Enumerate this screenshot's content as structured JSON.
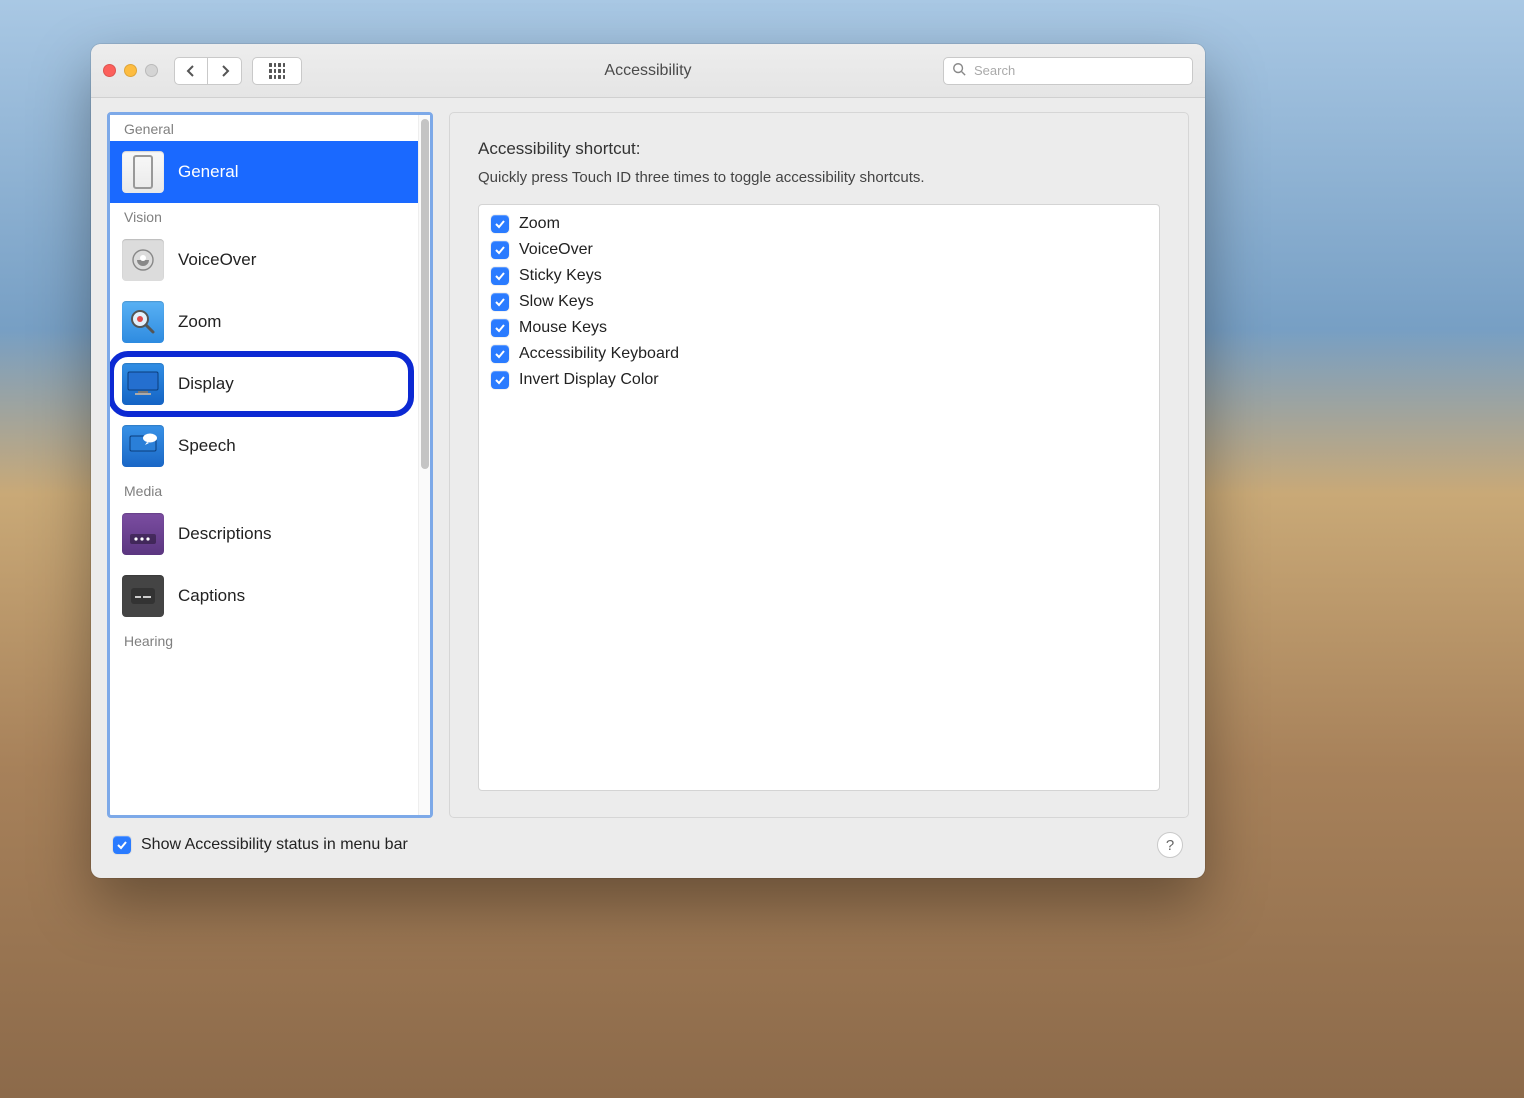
{
  "window": {
    "title": "Accessibility"
  },
  "search": {
    "placeholder": "Search"
  },
  "sidebar": {
    "sections": [
      {
        "label": "General",
        "items": [
          {
            "label": "General",
            "icon": "switch",
            "selected": true,
            "highlighted": false
          }
        ]
      },
      {
        "label": "Vision",
        "items": [
          {
            "label": "VoiceOver",
            "icon": "voiceover",
            "selected": false,
            "highlighted": false
          },
          {
            "label": "Zoom",
            "icon": "zoom",
            "selected": false,
            "highlighted": false
          },
          {
            "label": "Display",
            "icon": "display",
            "selected": false,
            "highlighted": true
          },
          {
            "label": "Speech",
            "icon": "speech",
            "selected": false,
            "highlighted": false
          }
        ]
      },
      {
        "label": "Media",
        "items": [
          {
            "label": "Descriptions",
            "icon": "descriptions",
            "selected": false,
            "highlighted": false
          },
          {
            "label": "Captions",
            "icon": "captions",
            "selected": false,
            "highlighted": false
          }
        ]
      },
      {
        "label": "Hearing",
        "items": []
      }
    ]
  },
  "detail": {
    "heading": "Accessibility shortcut:",
    "subtext": "Quickly press Touch ID three times to toggle accessibility shortcuts.",
    "shortcuts": [
      {
        "label": "Zoom",
        "checked": true
      },
      {
        "label": "VoiceOver",
        "checked": true
      },
      {
        "label": "Sticky Keys",
        "checked": true
      },
      {
        "label": "Slow Keys",
        "checked": true
      },
      {
        "label": "Mouse Keys",
        "checked": true
      },
      {
        "label": "Accessibility Keyboard",
        "checked": true
      },
      {
        "label": "Invert Display Color",
        "checked": true
      }
    ]
  },
  "footer": {
    "label": "Show Accessibility status in menu bar",
    "checked": true
  },
  "help_label": "?"
}
